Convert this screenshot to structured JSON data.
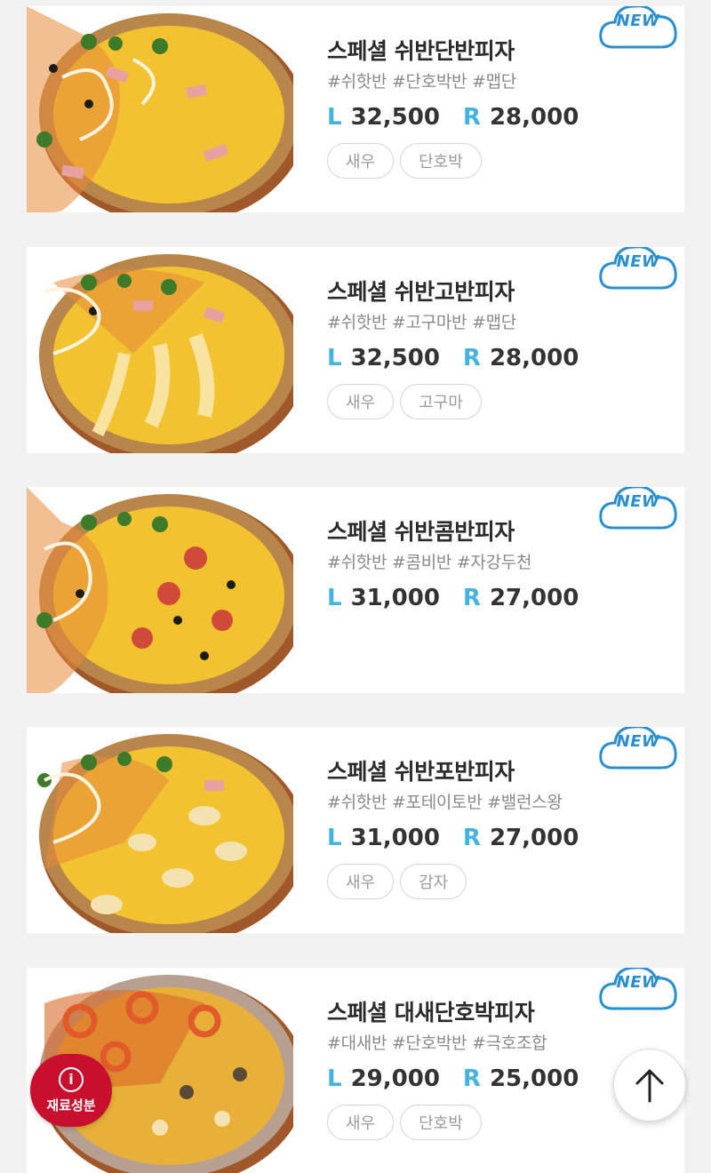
{
  "badge_text": "NEW",
  "size_labels": {
    "large": "L",
    "regular": "R"
  },
  "products": [
    {
      "name": "스페셜 쉬반단반피자",
      "tags": "#쉬핫반 #단호박반 #맵단",
      "price_l": "32,500",
      "price_r": "28,000",
      "chips": [
        "새우",
        "단호박"
      ]
    },
    {
      "name": "스페셜 쉬반고반피자",
      "tags": "#쉬핫반 #고구마반 #맵단",
      "price_l": "32,500",
      "price_r": "28,000",
      "chips": [
        "새우",
        "고구마"
      ]
    },
    {
      "name": "스페셜 쉬반콤반피자",
      "tags": "#쉬핫반 #콤비반 #자강두천",
      "price_l": "31,000",
      "price_r": "27,000",
      "chips": []
    },
    {
      "name": "스페셜 쉬반포반피자",
      "tags": "#쉬핫반 #포테이토반 #밸런스왕",
      "price_l": "31,000",
      "price_r": "27,000",
      "chips": [
        "새우",
        "감자"
      ]
    },
    {
      "name": "스페셜 대새단호박피자",
      "tags": "#대새반 #단호박반 #극호조합",
      "price_l": "29,000",
      "price_r": "25,000",
      "chips": [
        "새우",
        "단호박"
      ]
    }
  ],
  "floating": {
    "ingredient_label": "재료성분",
    "info_icon": "i",
    "scroll_top_icon": "arrow-up-icon"
  },
  "colors": {
    "accent_blue": "#45b3e0",
    "badge_blue": "#2a8fd0",
    "ingredient_red": "#c8102e"
  }
}
